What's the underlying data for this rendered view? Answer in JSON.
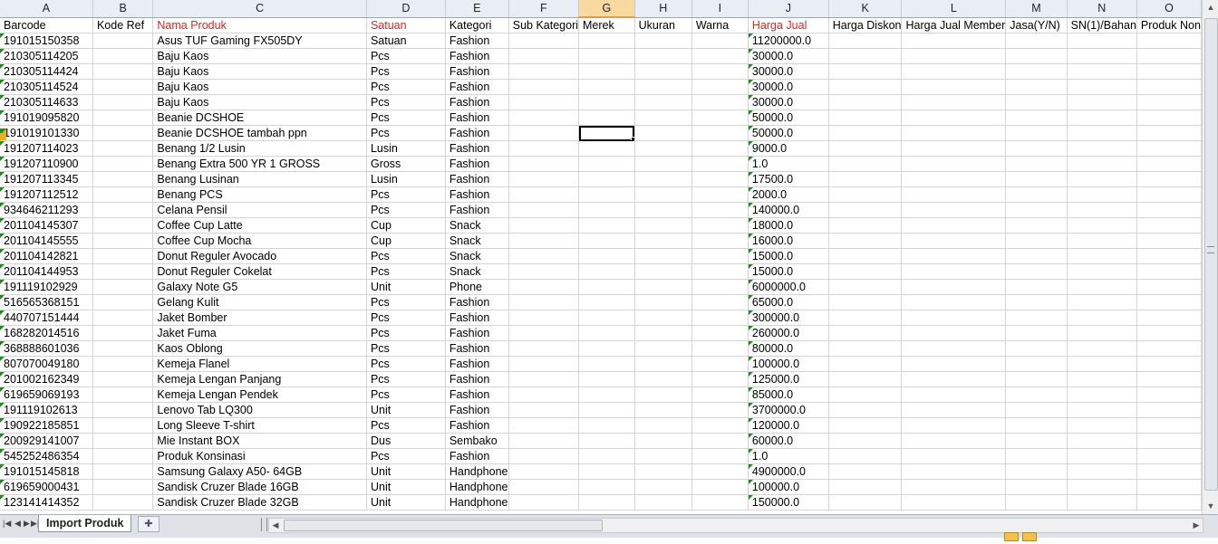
{
  "columns": [
    "A",
    "B",
    "C",
    "D",
    "E",
    "F",
    "G",
    "H",
    "I",
    "J",
    "K",
    "L",
    "M",
    "N",
    "O"
  ],
  "selected_column": "G",
  "header_row": [
    "Barcode",
    "Kode Ref",
    "Nama Produk",
    "Satuan",
    "Kategori",
    "Sub Kategori",
    "Merek",
    "Ukuran",
    "Warna",
    "Harga Jual",
    "Harga Diskon",
    "Harga Jual Member",
    "Jasa(Y/N)",
    "SN(1)/Bahan",
    "Produk Non"
  ],
  "rows": [
    [
      "191015150358",
      "",
      "Asus TUF Gaming FX505DY",
      "Satuan",
      "Fashion",
      "",
      "",
      "",
      "",
      "11200000.0"
    ],
    [
      "210305114205",
      "",
      "Baju Kaos",
      "Pcs",
      "Fashion",
      "",
      "",
      "",
      "",
      "30000.0"
    ],
    [
      "210305114424",
      "",
      "Baju Kaos",
      "Pcs",
      "Fashion",
      "",
      "",
      "",
      "",
      "30000.0"
    ],
    [
      "210305114524",
      "",
      "Baju Kaos",
      "Pcs",
      "Fashion",
      "",
      "",
      "",
      "",
      "30000.0"
    ],
    [
      "210305114633",
      "",
      "Baju Kaos",
      "Pcs",
      "Fashion",
      "",
      "",
      "",
      "",
      "30000.0"
    ],
    [
      "191019095820",
      "",
      "Beanie DCSHOE",
      "Pcs",
      "Fashion",
      "",
      "",
      "",
      "",
      "50000.0"
    ],
    [
      "191019101330",
      "",
      "Beanie DCSHOE tambah ppn",
      "Pcs",
      "Fashion",
      "",
      "",
      "",
      "",
      "50000.0"
    ],
    [
      "191207114023",
      "",
      "Benang 1/2 Lusin",
      "Lusin",
      "Fashion",
      "",
      "",
      "",
      "",
      "9000.0"
    ],
    [
      "191207110900",
      "",
      "Benang Extra 500 YR 1 GROSS",
      "Gross",
      "Fashion",
      "",
      "",
      "",
      "",
      "1.0"
    ],
    [
      "191207113345",
      "",
      "Benang Lusinan",
      "Lusin",
      "Fashion",
      "",
      "",
      "",
      "",
      "17500.0"
    ],
    [
      "191207112512",
      "",
      "Benang PCS",
      "Pcs",
      "Fashion",
      "",
      "",
      "",
      "",
      "2000.0"
    ],
    [
      "934646211293",
      "",
      "Celana Pensil",
      "Pcs",
      "Fashion",
      "",
      "",
      "",
      "",
      "140000.0"
    ],
    [
      "201104145307",
      "",
      "Coffee Cup Latte",
      "Cup",
      "Snack",
      "",
      "",
      "",
      "",
      "18000.0"
    ],
    [
      "201104145555",
      "",
      "Coffee Cup Mocha",
      "Cup",
      "Snack",
      "",
      "",
      "",
      "",
      "16000.0"
    ],
    [
      "201104142821",
      "",
      "Donut Reguler Avocado",
      "Pcs",
      "Snack",
      "",
      "",
      "",
      "",
      "15000.0"
    ],
    [
      "201104144953",
      "",
      "Donut Reguler Cokelat",
      "Pcs",
      "Snack",
      "",
      "",
      "",
      "",
      "15000.0"
    ],
    [
      "191119102929",
      "",
      "Galaxy Note G5",
      "Unit",
      "Phone",
      "",
      "",
      "",
      "",
      "6000000.0"
    ],
    [
      "516565368151",
      "",
      "Gelang Kulit",
      "Pcs",
      "Fashion",
      "",
      "",
      "",
      "",
      "65000.0"
    ],
    [
      "440707151444",
      "",
      "Jaket Bomber",
      "Pcs",
      "Fashion",
      "",
      "",
      "",
      "",
      "300000.0"
    ],
    [
      "168282014516",
      "",
      "Jaket Fuma",
      "Pcs",
      "Fashion",
      "",
      "",
      "",
      "",
      "260000.0"
    ],
    [
      "368888601036",
      "",
      "Kaos Oblong",
      "Pcs",
      "Fashion",
      "",
      "",
      "",
      "",
      "80000.0"
    ],
    [
      "807070049180",
      "",
      "Kemeja Flanel",
      "Pcs",
      "Fashion",
      "",
      "",
      "",
      "",
      "100000.0"
    ],
    [
      "201002162349",
      "",
      "Kemeja Lengan Panjang",
      "Pcs",
      "Fashion",
      "",
      "",
      "",
      "",
      "125000.0"
    ],
    [
      "619659069193",
      "",
      "Kemeja Lengan Pendek",
      "Pcs",
      "Fashion",
      "",
      "",
      "",
      "",
      "85000.0"
    ],
    [
      "191119102613",
      "",
      "Lenovo Tab LQ300",
      "Unit",
      "Fashion",
      "",
      "",
      "",
      "",
      "3700000.0"
    ],
    [
      "190922185851",
      "",
      "Long Sleeve T-shirt",
      "Pcs",
      "Fashion",
      "",
      "",
      "",
      "",
      "120000.0"
    ],
    [
      "200929141007",
      "",
      "Mie Instant BOX",
      "Dus",
      "Sembako",
      "",
      "",
      "",
      "",
      "60000.0"
    ],
    [
      "545252486354",
      "",
      "Produk Konsinasi",
      "Pcs",
      "Fashion",
      "",
      "",
      "",
      "",
      "1.0"
    ],
    [
      "191015145818",
      "",
      "Samsung Galaxy A50- 64GB",
      "Unit",
      "Handphone",
      "",
      "",
      "",
      "",
      "4900000.0"
    ],
    [
      "619659000431",
      "",
      "Sandisk Cruzer Blade 16GB",
      "Unit",
      "Handphone",
      "",
      "",
      "",
      "",
      "100000.0"
    ],
    [
      "123141414352",
      "",
      "Sandisk Cruzer Blade 32GB",
      "Unit",
      "Handphone",
      "",
      "",
      "",
      "",
      "150000.0"
    ]
  ],
  "sheet_tab": "Import Produk",
  "colors": {
    "required_header": "#e0251c",
    "selected_col_header": "#f9d99f"
  }
}
